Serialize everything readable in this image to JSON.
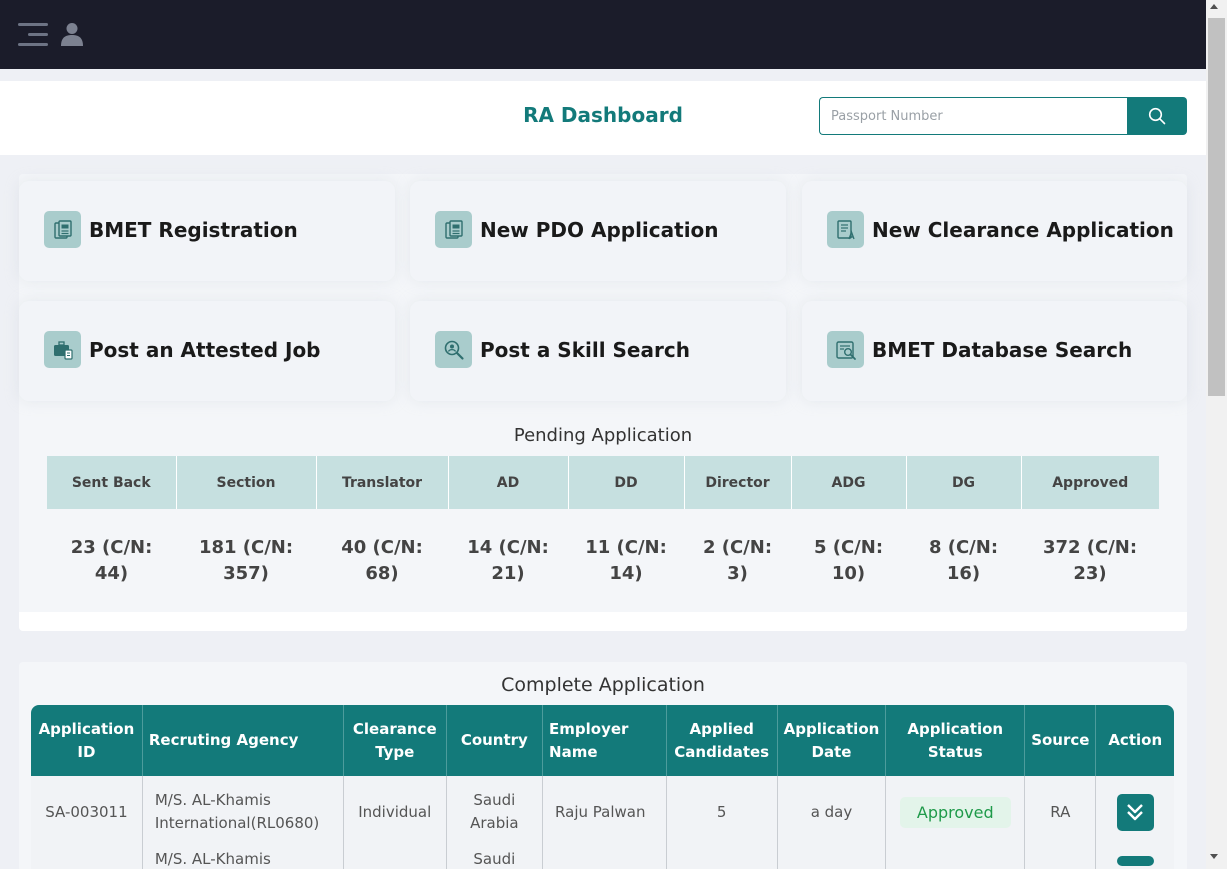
{
  "header": {
    "title": "RA Dashboard",
    "search_placeholder": "Passport Number",
    "search_value": ""
  },
  "quick_links": [
    {
      "label": "BMET Registration",
      "icon": "registration-document-icon"
    },
    {
      "label": "New PDO Application",
      "icon": "pdo-document-icon"
    },
    {
      "label": "New Clearance Application",
      "icon": "clearance-document-icon"
    },
    {
      "label": "Post an Attested Job",
      "icon": "briefcase-icon"
    },
    {
      "label": "Post a Skill Search",
      "icon": "skill-search-icon"
    },
    {
      "label": "BMET Database Search",
      "icon": "database-search-icon"
    }
  ],
  "pending": {
    "title": "Pending Application",
    "columns": [
      "Sent Back",
      "Section",
      "Translator",
      "AD",
      "DD",
      "Director",
      "ADG",
      "DG",
      "Approved"
    ],
    "values": [
      "23 (C/N: 44)",
      "181 (C/N: 357)",
      "40 (C/N: 68)",
      "14 (C/N: 21)",
      "11 (C/N: 14)",
      "2 (C/N: 3)",
      "5 (C/N: 10)",
      "8 (C/N: 16)",
      "372 (C/N: 23)"
    ]
  },
  "complete": {
    "title": "Complete Application",
    "columns": [
      "Application ID",
      "Recruting Agency",
      "Clearance Type",
      "Country",
      "Employer Name",
      "Applied Candidates",
      "Application Date",
      "Application Status",
      "Source",
      "Action"
    ],
    "rows": [
      {
        "id": "SA-003011",
        "agency": "M/S. AL-Khamis International(RL0680)",
        "clearance_type": "Individual",
        "country": "Saudi Arabia",
        "employer": "Raju Palwan",
        "applied": "5",
        "date": "a day",
        "status": "Approved",
        "source": "RA"
      },
      {
        "id": "",
        "agency": "M/S. AL-Khamis",
        "clearance_type": "",
        "country": "Saudi",
        "employer": "",
        "applied": "",
        "date": "",
        "status": "",
        "source": ""
      }
    ]
  },
  "colors": {
    "topbar": "#1b1c2a",
    "accent": "#137a7a",
    "pending_header": "#c6e0e0",
    "status_approved": "#1f9a4a"
  }
}
